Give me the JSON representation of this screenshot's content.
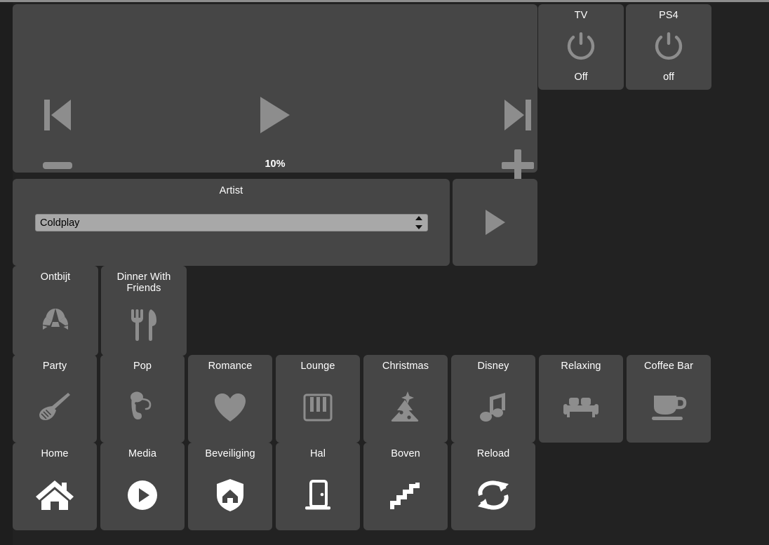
{
  "theme": {
    "background": "#222222",
    "tile": "#464646",
    "icon_gray": "#8d8d8d",
    "icon_white": "#ffffff",
    "text": "#ffffff",
    "select_bg": "#a8a8a8"
  },
  "media_player": {
    "name": "media-player",
    "prev_icon": "skip-previous-icon",
    "play_icon": "play-icon",
    "next_icon": "skip-next-icon",
    "volume_down_icon": "minus-icon",
    "volume_up_icon": "plus-icon",
    "volume_percent": "10%"
  },
  "power_tiles": [
    {
      "label": "TV",
      "state": "Off",
      "icon": "power-icon",
      "name": "tile-tv"
    },
    {
      "label": "PS4",
      "state": "off",
      "icon": "power-icon",
      "name": "tile-ps4"
    }
  ],
  "artist": {
    "title": "Artist",
    "selected": "Coldplay",
    "options": [
      "Coldplay"
    ],
    "play_icon": "play-icon"
  },
  "meal_tiles": [
    {
      "label": "Ontbijt",
      "icon": "croissant-icon",
      "name": "tile-ontbijt"
    },
    {
      "label": "Dinner With Friends",
      "icon": "cutlery-icon",
      "name": "tile-dinner"
    }
  ],
  "mood_tiles": [
    {
      "label": "Party",
      "icon": "guitar-icon"
    },
    {
      "label": "Pop",
      "icon": "microphone-icon"
    },
    {
      "label": "Romance",
      "icon": "heart-icon"
    },
    {
      "label": "Lounge",
      "icon": "piano-icon"
    },
    {
      "label": "Christmas",
      "icon": "christmas-tree-icon"
    },
    {
      "label": "Disney",
      "icon": "music-note-icon"
    },
    {
      "label": "Relaxing",
      "icon": "sofa-icon"
    },
    {
      "label": "Coffee Bar",
      "icon": "coffee-cup-icon"
    }
  ],
  "nav_tiles": [
    {
      "label": "Home",
      "icon": "home-icon"
    },
    {
      "label": "Media",
      "icon": "play-circle-icon"
    },
    {
      "label": "Beveiliging",
      "icon": "shield-home-icon"
    },
    {
      "label": "Hal",
      "icon": "door-icon"
    },
    {
      "label": "Boven",
      "icon": "stairs-icon"
    },
    {
      "label": "Reload",
      "icon": "refresh-icon"
    }
  ]
}
